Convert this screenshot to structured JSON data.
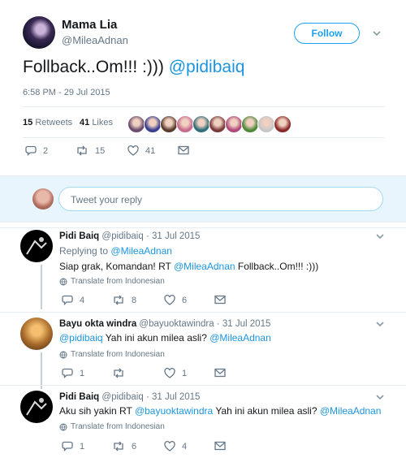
{
  "tweet": {
    "author_name": "Mama Lia",
    "author_handle": "@MileaAdnan",
    "follow_label": "Follow",
    "text_main": "Follback..Om!!! :)))",
    "text_mention": "@pidibaiq",
    "timestamp": "6:58 PM - 29 Jul 2015",
    "retweets_count": "15",
    "retweets_label": "Retweets",
    "likes_count": "41",
    "likes_label": "Likes",
    "actions": {
      "replies": "2",
      "retweets": "15",
      "likes": "41"
    },
    "avatar_colors": [
      "#6b4c6e",
      "#3a3f8f",
      "#5a3b2e",
      "#c96b8f",
      "#2f6f78",
      "#7a3b3b",
      "#b04a7a",
      "#4e8a3a",
      "#c7c7c7",
      "#8a2a2a"
    ]
  },
  "compose": {
    "placeholder": "Tweet your reply"
  },
  "replies": [
    {
      "name": "Pidi Baiq",
      "handle": "@pidibaiq",
      "sep": "·",
      "date": "31 Jul 2015",
      "replying_to_label": "Replying to",
      "replying_to_handle": "@MileaAdnan",
      "text_before": "Siap grak, Komandan! RT",
      "text_mention": "@MileaAdnan",
      "text_after": "Follback..Om!!! :)))",
      "translate": "Translate from Indonesian",
      "replies": "4",
      "retweets": "8",
      "likes": "6"
    },
    {
      "name": "Bayu okta windra",
      "handle": "@bayuoktawindra",
      "sep": "·",
      "date": "31 Jul 2015",
      "text_mention": "@pidibaiq",
      "text_middle": "Yah ini akun milea asli?",
      "text_mention2": "@MileaAdnan",
      "translate": "Translate from Indonesian",
      "replies": "1",
      "retweets": "",
      "likes": "1"
    },
    {
      "name": "Pidi Baiq",
      "handle": "@pidibaiq",
      "sep": "·",
      "date": "31 Jul 2015",
      "text_before": "Aku sih yakin RT",
      "text_mention": "@bayuoktawindra",
      "text_middle": "Yah ini akun milea asli?",
      "text_mention2": "@MileaAdnan",
      "translate": "Translate from Indonesian",
      "replies": "1",
      "retweets": "6",
      "likes": "4"
    }
  ]
}
